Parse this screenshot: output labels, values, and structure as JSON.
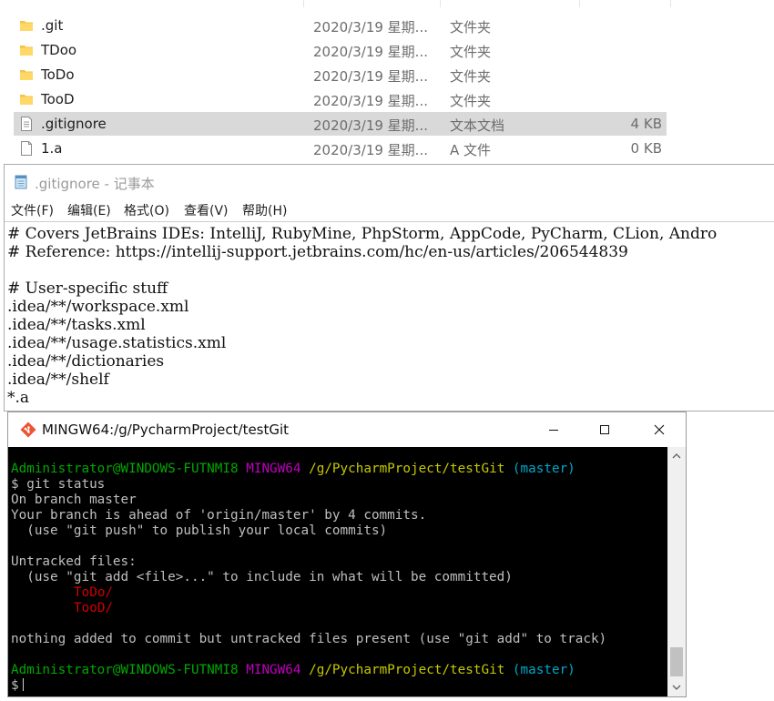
{
  "explorer": {
    "files": [
      {
        "name": ".git",
        "date": "2020/3/19 星期...",
        "type": "文件夹",
        "size": "",
        "icon": "folder-icon"
      },
      {
        "name": "TDoo",
        "date": "2020/3/19 星期...",
        "type": "文件夹",
        "size": "",
        "icon": "folder-icon"
      },
      {
        "name": "ToDo",
        "date": "2020/3/19 星期...",
        "type": "文件夹",
        "size": "",
        "icon": "folder-icon"
      },
      {
        "name": "TooD",
        "date": "2020/3/19 星期...",
        "type": "文件夹",
        "size": "",
        "icon": "folder-icon"
      },
      {
        "name": ".gitignore",
        "date": "2020/3/19 星期...",
        "type": "文本文档",
        "size": "4 KB",
        "icon": "text-file-icon",
        "selected": true
      },
      {
        "name": "1.a",
        "date": "2020/3/19 星期...",
        "type": "A 文件",
        "size": "0 KB",
        "icon": "file-icon"
      }
    ]
  },
  "notepad": {
    "title": ".gitignore - 记事本",
    "menu": [
      "文件(F)",
      "编辑(E)",
      "格式(O)",
      "查看(V)",
      "帮助(H)"
    ],
    "lines": [
      "# Covers JetBrains IDEs: IntelliJ, RubyMine, PhpStorm, AppCode, PyCharm, CLion, Andro",
      "# Reference: https://intellij-support.jetbrains.com/hc/en-us/articles/206544839",
      "",
      "# User-specific stuff",
      ".idea/**/workspace.xml",
      ".idea/**/tasks.xml",
      ".idea/**/usage.statistics.xml",
      ".idea/**/dictionaries",
      ".idea/**/shelf",
      "*.a"
    ]
  },
  "gitbash": {
    "title": "MINGW64:/g/PycharmProject/testGit",
    "prompt": {
      "user": "Administrator@WINDOWS-FUTNMI8",
      "env": "MINGW64",
      "path": "/g/PycharmProject/testGit",
      "branch": "(master)"
    },
    "command": "$ git status",
    "output": [
      "On branch master",
      "Your branch is ahead of 'origin/master' by 4 commits.",
      "  (use \"git push\" to publish your local commits)",
      "",
      "Untracked files:",
      "  (use \"git add <file>...\" to include in what will be committed)"
    ],
    "untracked": [
      "ToDo/",
      "TooD/"
    ],
    "summary": "nothing added to commit but untracked files present (use \"git add\" to track)",
    "final_prompt": "$",
    "colors": {
      "user": "#00a800",
      "env": "#c000c0",
      "path": "#c8c800",
      "branch": "#00a8c8",
      "untracked": "#d00000"
    }
  }
}
